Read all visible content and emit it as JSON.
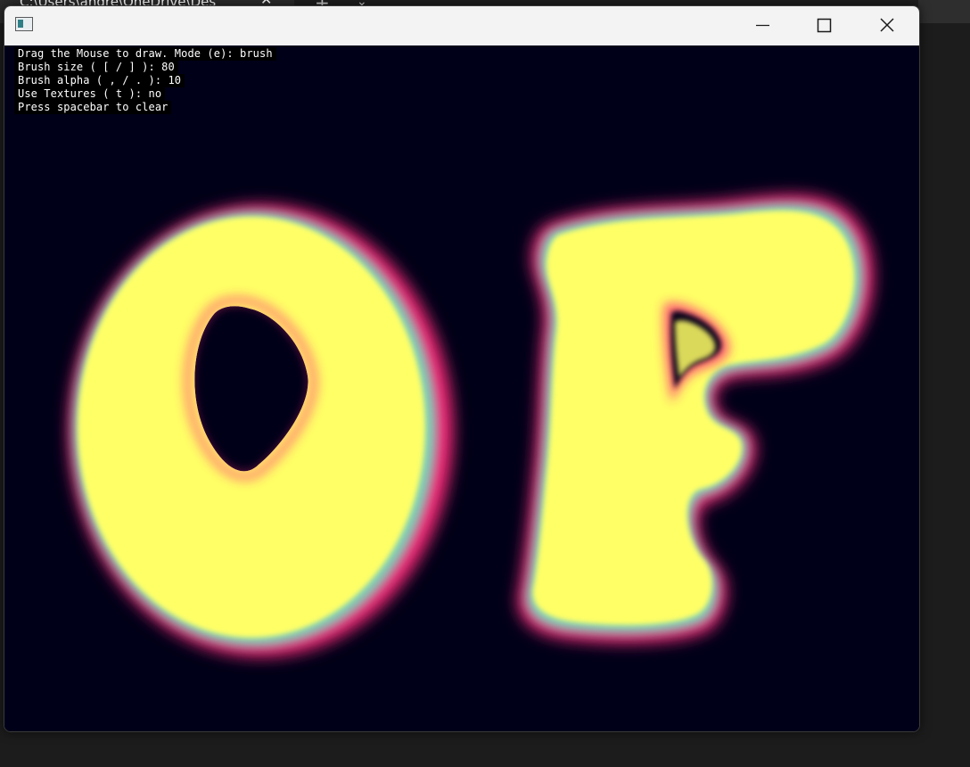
{
  "background_tab": {
    "title": "C:\\Users\\andre\\OneDrive\\Des",
    "close_glyph": "✕",
    "new_tab_glyph": "+",
    "menu_glyph": "⌄"
  },
  "window": {
    "icon": "app-window-icon",
    "controls": {
      "minimize_icon": "minimize-icon",
      "maximize_icon": "maximize-icon",
      "close_icon": "close-icon"
    }
  },
  "overlay": {
    "lines": [
      "Drag the Mouse to draw. Mode (e): brush",
      "Brush size ( [ / ] ): 80",
      "Brush alpha ( , / . ): 10",
      "Use Textures ( t ): no",
      "Press spacebar to clear"
    ]
  },
  "colors": {
    "canvas_background": "#000018",
    "stroke_core": "#ffff66",
    "stroke_mid": "#7fd3b8",
    "stroke_edge": "#ff2a7a"
  }
}
